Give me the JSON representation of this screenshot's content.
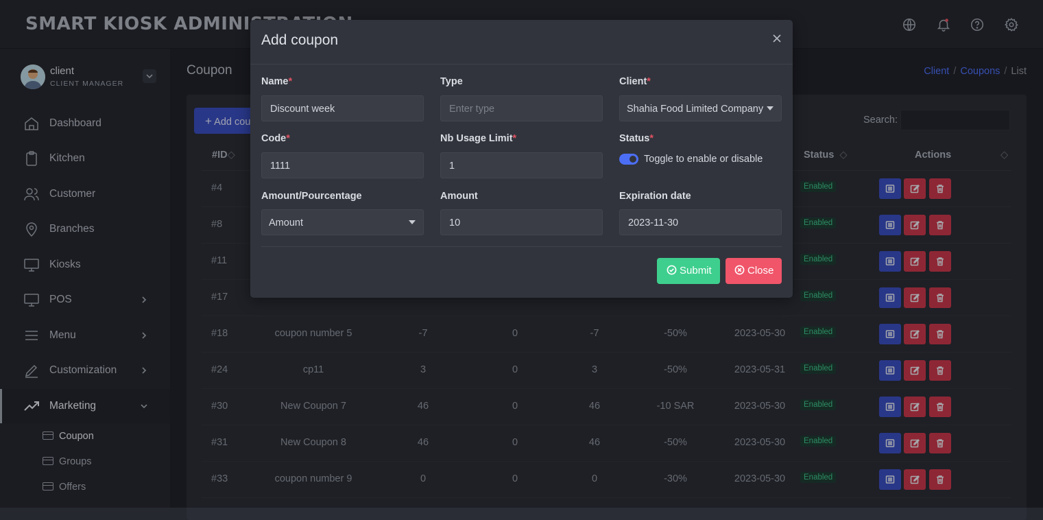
{
  "app": {
    "title": "SMART KIOSK ADMINISTRATION"
  },
  "topbar": {
    "icons": [
      "globe-icon",
      "bell-icon",
      "help-icon",
      "gear-icon"
    ]
  },
  "user": {
    "name": "client",
    "role": "CLIENT MANAGER"
  },
  "sidebar": {
    "items": [
      {
        "label": "Dashboard",
        "icon": "home-icon"
      },
      {
        "label": "Kitchen",
        "icon": "clipboard-icon"
      },
      {
        "label": "Customer",
        "icon": "users-icon"
      },
      {
        "label": "Branches",
        "icon": "map-pin-icon"
      },
      {
        "label": "Kiosks",
        "icon": "monitor-icon"
      },
      {
        "label": "POS",
        "icon": "monitor-icon"
      },
      {
        "label": "Menu",
        "icon": "menu-icon"
      },
      {
        "label": "Customization",
        "icon": "pen-icon"
      },
      {
        "label": "Marketing",
        "icon": "trending-up-icon"
      }
    ],
    "marketing_sub": [
      {
        "label": "Coupon"
      },
      {
        "label": "Groups"
      },
      {
        "label": "Offers"
      }
    ]
  },
  "page": {
    "title": "Coupon",
    "breadcrumb": {
      "a": "Client",
      "b": "Coupons",
      "c": "List"
    }
  },
  "table": {
    "add_label": "Add cou",
    "search_label": "Search:",
    "headers": {
      "id": "#ID",
      "status": "Status",
      "actions": "Actions"
    },
    "rows": [
      {
        "id": "#4",
        "c1": "",
        "c2": "",
        "c3": "",
        "c4": "",
        "c5": "",
        "c6": "",
        "status": "Enabled"
      },
      {
        "id": "#8",
        "c1": "",
        "c2": "",
        "c3": "",
        "c4": "",
        "c5": "",
        "c6": "",
        "status": "Enabled"
      },
      {
        "id": "#11",
        "c1": "",
        "c2": "",
        "c3": "",
        "c4": "",
        "c5": "",
        "c6": "",
        "status": "Enabled"
      },
      {
        "id": "#17",
        "c1": "",
        "c2": "",
        "c3": "",
        "c4": "",
        "c5": "",
        "c6": "",
        "status": "Enabled"
      },
      {
        "id": "#18",
        "c1": "coupon number 5",
        "c2": "-7",
        "c3": "0",
        "c4": "-7",
        "c5": "-50%",
        "c6": "2023-05-30",
        "status": "Enabled"
      },
      {
        "id": "#24",
        "c1": "cp11",
        "c2": "3",
        "c3": "0",
        "c4": "3",
        "c5": "-50%",
        "c6": "2023-05-31",
        "status": "Enabled"
      },
      {
        "id": "#30",
        "c1": "New Coupon 7",
        "c2": "46",
        "c3": "0",
        "c4": "46",
        "c5": "-10 SAR",
        "c6": "2023-05-30",
        "status": "Enabled"
      },
      {
        "id": "#31",
        "c1": "New Coupon 8",
        "c2": "46",
        "c3": "0",
        "c4": "46",
        "c5": "-50%",
        "c6": "2023-05-30",
        "status": "Enabled"
      },
      {
        "id": "#33",
        "c1": "coupon number 9",
        "c2": "0",
        "c3": "0",
        "c4": "0",
        "c5": "-30%",
        "c6": "2023-05-30",
        "status": "Enabled"
      }
    ]
  },
  "modal": {
    "title": "Add coupon",
    "fields": {
      "name": {
        "label": "Name",
        "value": "Discount week"
      },
      "type": {
        "label": "Type",
        "placeholder": "Enter type"
      },
      "client": {
        "label": "Client",
        "value": "Shahia Food Limited Company"
      },
      "code": {
        "label": "Code",
        "value": "1111"
      },
      "nb_usage": {
        "label": "Nb Usage Limit",
        "value": "1"
      },
      "status": {
        "label": "Status",
        "toggle_label": "Toggle to enable or disable",
        "enabled": true
      },
      "amount_type": {
        "label": "Amount/Pourcentage",
        "value": "Amount"
      },
      "amount": {
        "label": "Amount",
        "value": "10"
      },
      "expiration": {
        "label": "Expiration date",
        "value": "2023-11-30"
      }
    },
    "submit_label": "Submit",
    "close_label": "Close"
  },
  "colors": {
    "accent": "#4c6ef5",
    "submit": "#3ecf8e",
    "close": "#f0556a",
    "danger": "#c5374a",
    "enabled": "#3fc48b"
  }
}
